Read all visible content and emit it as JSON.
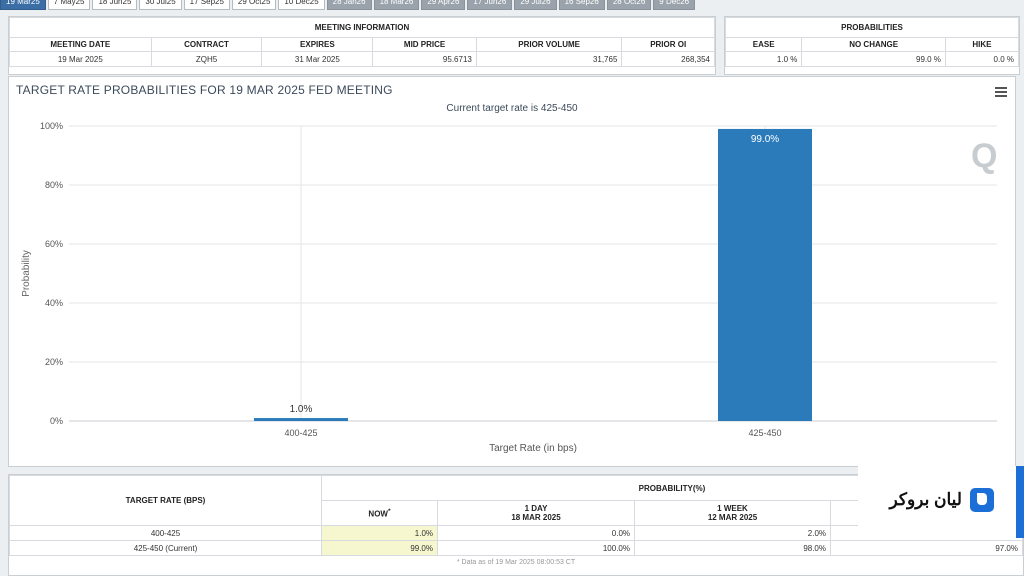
{
  "tabs": [
    {
      "label": "19 Mar25",
      "state": "active"
    },
    {
      "label": "7 May25",
      "state": "normal"
    },
    {
      "label": "18 Jun25",
      "state": "normal"
    },
    {
      "label": "30 Jul25",
      "state": "normal"
    },
    {
      "label": "17 Sep25",
      "state": "normal"
    },
    {
      "label": "29 Oct25",
      "state": "normal"
    },
    {
      "label": "10 Dec25",
      "state": "normal"
    },
    {
      "label": "28 Jan26",
      "state": "dim"
    },
    {
      "label": "18 Mar26",
      "state": "dim"
    },
    {
      "label": "29 Apr26",
      "state": "dim"
    },
    {
      "label": "17 Jun26",
      "state": "dim"
    },
    {
      "label": "29 Jul26",
      "state": "dim"
    },
    {
      "label": "16 Sep26",
      "state": "dim"
    },
    {
      "label": "28 Oct26",
      "state": "dim"
    },
    {
      "label": "9 Dec26",
      "state": "dim"
    }
  ],
  "meeting_info": {
    "title": "MEETING INFORMATION",
    "headers": [
      "MEETING DATE",
      "CONTRACT",
      "EXPIRES",
      "MID PRICE",
      "PRIOR VOLUME",
      "PRIOR OI"
    ],
    "values": [
      "19 Mar 2025",
      "ZQH5",
      "31 Mar 2025",
      "95.6713",
      "31,765",
      "268,354"
    ]
  },
  "probabilities": {
    "title": "PROBABILITIES",
    "headers": [
      "EASE",
      "NO CHANGE",
      "HIKE"
    ],
    "values": [
      "1.0 %",
      "99.0 %",
      "0.0 %"
    ]
  },
  "chart": {
    "title": "TARGET RATE PROBABILITIES FOR 19 MAR 2025 FED MEETING",
    "subtitle": "Current target rate is 425-450"
  },
  "chart_data": {
    "type": "bar",
    "categories": [
      "400-425",
      "425-450"
    ],
    "values": [
      1.0,
      99.0
    ],
    "data_labels": [
      "1.0%",
      "99.0%"
    ],
    "title": "TARGET RATE PROBABILITIES FOR 19 MAR 2025 FED MEETING",
    "subtitle": "Current target rate is 425-450",
    "xlabel": "Target Rate (in bps)",
    "ylabel": "Probability",
    "ylim": [
      0,
      100
    ],
    "yticks": [
      "0%",
      "20%",
      "40%",
      "60%",
      "80%",
      "100%"
    ],
    "bar_color": "#2b7bba",
    "grid": true
  },
  "bottom_table": {
    "col_rate": "TARGET RATE (BPS)",
    "col_prob": "PROBABILITY(%)",
    "now": "NOW",
    "now_mark": "*",
    "day_label": "1 DAY",
    "day_date": "18 MAR 2025",
    "week_label": "1 WEEK",
    "week_date": "12 MAR 2025",
    "rows": [
      {
        "rate": "400-425",
        "now": "1.0%",
        "day": "0.0%",
        "week": "2.0%",
        "month": ""
      },
      {
        "rate": "425-450 (Current)",
        "now": "99.0%",
        "day": "100.0%",
        "week": "98.0%",
        "month": "97.0%"
      }
    ],
    "footnote": "* Data as of 19 Mar 2025 08:00:53 CT"
  },
  "brand": {
    "text": "لیان بروکر",
    "color": "#1b6fd6"
  }
}
